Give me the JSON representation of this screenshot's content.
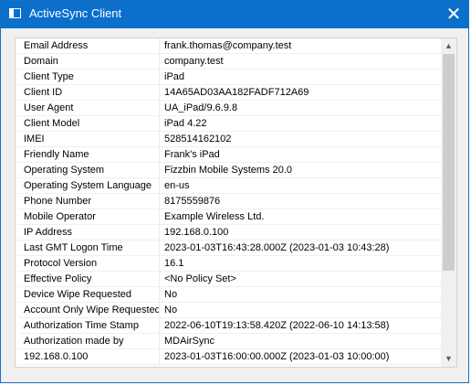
{
  "window": {
    "title": "ActiveSync Client",
    "close_glyph": "✕"
  },
  "rows": [
    {
      "key": "Email Address",
      "value": "frank.thomas@company.test"
    },
    {
      "key": "Domain",
      "value": "company.test"
    },
    {
      "key": "Client Type",
      "value": "iPad"
    },
    {
      "key": "Client ID",
      "value": "14A65AD03AA182FADF712A69"
    },
    {
      "key": "User Agent",
      "value": "UA_iPad/9.6.9.8"
    },
    {
      "key": "Client Model",
      "value": "iPad 4.22"
    },
    {
      "key": "IMEI",
      "value": "528514162102"
    },
    {
      "key": "Friendly Name",
      "value": "Frank's iPad"
    },
    {
      "key": "Operating System",
      "value": "Fizzbin Mobile Systems 20.0"
    },
    {
      "key": "Operating System Language",
      "value": "en-us"
    },
    {
      "key": "Phone Number",
      "value": "8175559876"
    },
    {
      "key": "Mobile Operator",
      "value": "Example Wireless Ltd."
    },
    {
      "key": "IP Address",
      "value": "192.168.0.100"
    },
    {
      "key": "Last GMT Logon Time",
      "value": "2023-01-03T16:43:28.000Z (2023-01-03 10:43:28)"
    },
    {
      "key": "Protocol Version",
      "value": "16.1"
    },
    {
      "key": "Effective Policy",
      "value": "<No Policy Set>"
    },
    {
      "key": "Device Wipe Requested",
      "value": "No"
    },
    {
      "key": "Account Only Wipe Requested",
      "value": "No"
    },
    {
      "key": "Authorization Time Stamp",
      "value": "2022-06-10T19:13:58.420Z (2022-06-10 14:13:58)"
    },
    {
      "key": "Authorization made by",
      "value": "MDAirSync"
    },
    {
      "key": "192.168.0.100",
      "value": "2023-01-03T16:00:00.000Z (2023-01-03 10:00:00)"
    }
  ],
  "scrollbar": {
    "up_glyph": "▲",
    "down_glyph": "▼"
  },
  "colors": {
    "titlebar": "#0b6fcc",
    "window_bg": "#f0f0f0",
    "list_bg": "#ffffff"
  }
}
